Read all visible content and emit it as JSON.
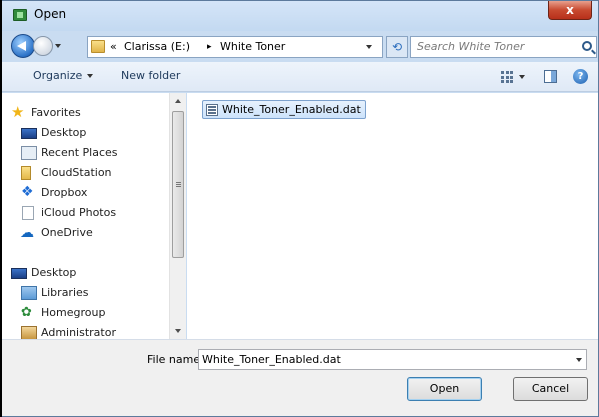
{
  "window": {
    "title": "Open",
    "close_glyph": "x"
  },
  "address": {
    "overflow": "«",
    "drive": "Clarissa (E:)",
    "separator": "▸",
    "folder": "White Toner"
  },
  "search": {
    "placeholder": "Search White Toner"
  },
  "toolbar": {
    "organize_label": "Organize",
    "new_folder_label": "New folder"
  },
  "nav": {
    "items": [
      {
        "label": "Favorites",
        "icon": "star-icon"
      },
      {
        "label": "Desktop",
        "icon": "desktop-icon"
      },
      {
        "label": "Recent Places",
        "icon": "recent-places-icon"
      },
      {
        "label": "CloudStation",
        "icon": "folder-icon"
      },
      {
        "label": "Dropbox",
        "icon": "dropbox-icon"
      },
      {
        "label": "iCloud Photos",
        "icon": "document-icon"
      },
      {
        "label": "OneDrive",
        "icon": "cloud-icon"
      },
      {
        "label": "Desktop",
        "icon": "desktop-icon"
      },
      {
        "label": "Libraries",
        "icon": "libraries-icon"
      },
      {
        "label": "Homegroup",
        "icon": "homegroup-icon"
      },
      {
        "label": "Administrator",
        "icon": "user-folder-icon"
      }
    ]
  },
  "files": [
    {
      "name": "White_Toner_Enabled.dat",
      "icon": "dat-file-icon",
      "selected": true
    }
  ],
  "footer": {
    "file_name_label": "File name:",
    "file_name_value": "White_Toner_Enabled.dat",
    "open_label": "Open",
    "cancel_label": "Cancel"
  }
}
